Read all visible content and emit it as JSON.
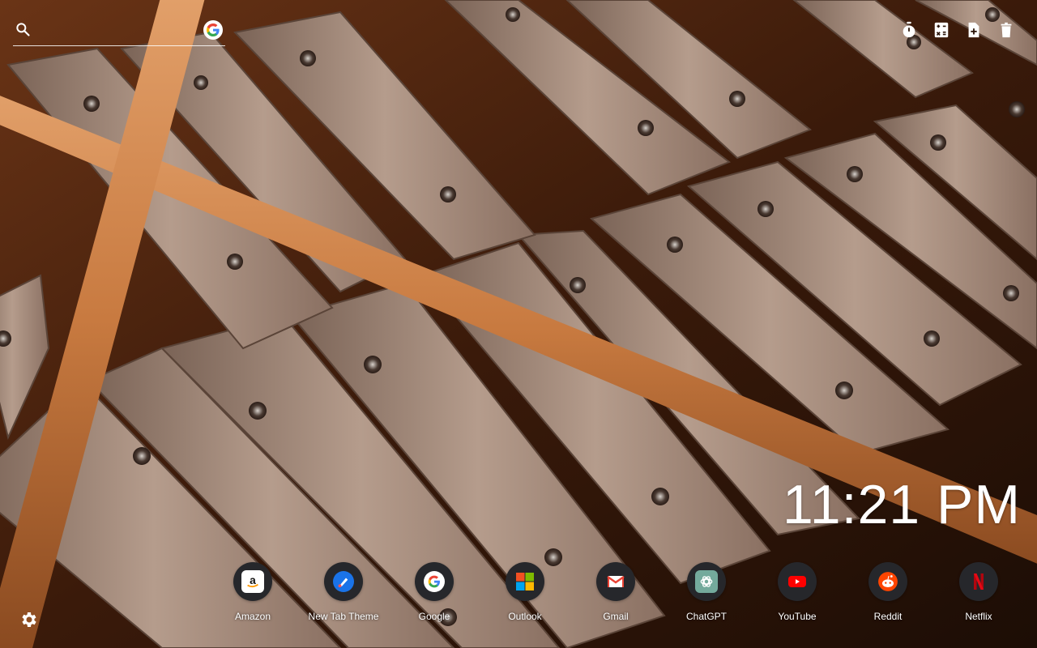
{
  "background": {
    "description_icon": "xylophone-wallpaper"
  },
  "search": {
    "placeholder": "",
    "engine_icon": "google-icon"
  },
  "toolbar": {
    "items": [
      {
        "name": "timer",
        "icon": "stopwatch-icon"
      },
      {
        "name": "calculator",
        "icon": "calculator-icon"
      },
      {
        "name": "add-note",
        "icon": "file-plus-icon"
      },
      {
        "name": "clear",
        "icon": "trash-icon"
      }
    ]
  },
  "clock": {
    "time": "11:21 PM"
  },
  "shortcuts": [
    {
      "label": "Amazon",
      "icon": "amazon-icon"
    },
    {
      "label": "New Tab Theme",
      "icon": "new-tab-theme-icon"
    },
    {
      "label": "Google",
      "icon": "google-icon"
    },
    {
      "label": "Outlook",
      "icon": "microsoft-icon"
    },
    {
      "label": "Gmail",
      "icon": "gmail-icon"
    },
    {
      "label": "ChatGPT",
      "icon": "chatgpt-icon"
    },
    {
      "label": "YouTube",
      "icon": "youtube-icon"
    },
    {
      "label": "Reddit",
      "icon": "reddit-icon"
    },
    {
      "label": "Netflix",
      "icon": "netflix-icon"
    }
  ],
  "settings": {
    "icon": "gear-icon"
  },
  "colors": {
    "accent": "#ffffff",
    "shortcut_bg": "#26272b"
  }
}
